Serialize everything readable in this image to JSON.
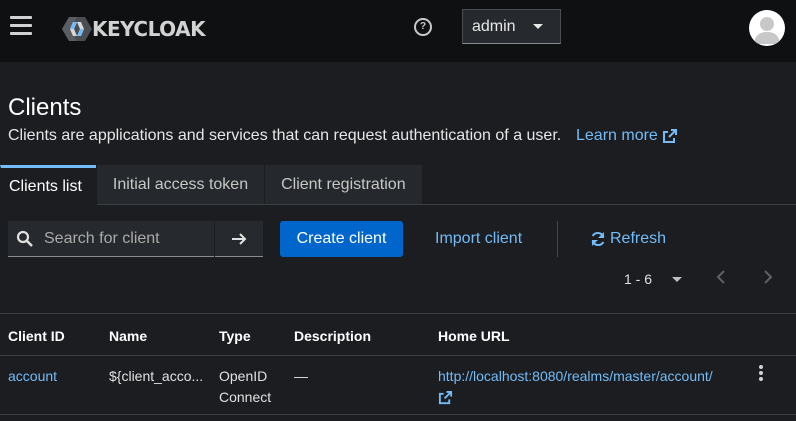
{
  "masthead": {
    "logo_text": "KEYCLOAK",
    "user_name": "admin"
  },
  "page": {
    "title": "Clients",
    "description": "Clients are applications and services that can request authentication of a user.",
    "learn_more": "Learn more"
  },
  "tabs": [
    {
      "label": "Clients list",
      "active": true
    },
    {
      "label": "Initial access token",
      "active": false
    },
    {
      "label": "Client registration",
      "active": false
    }
  ],
  "toolbar": {
    "search_placeholder": "Search for client",
    "create_label": "Create client",
    "import_label": "Import client",
    "refresh_label": "Refresh"
  },
  "pagination": {
    "range": "1 - 6"
  },
  "table": {
    "headers": [
      "Client ID",
      "Name",
      "Type",
      "Description",
      "Home URL"
    ],
    "rows": [
      {
        "client_id": "account",
        "name": "${client_acco...",
        "type_line1": "OpenID",
        "type_line2": "Connect",
        "description": "—",
        "home_url": "http://localhost:8080/realms/master/account/"
      }
    ]
  },
  "colors": {
    "accent": "#0066cc",
    "link": "#73bcf7",
    "background": "#1b1d21",
    "masthead": "#0f1012"
  },
  "icons": [
    "menu-icon",
    "keycloak-logo-icon",
    "help-icon",
    "avatar-icon",
    "search-icon",
    "arrow-right-icon",
    "sync-icon",
    "external-link-icon",
    "kebab-icon"
  ]
}
